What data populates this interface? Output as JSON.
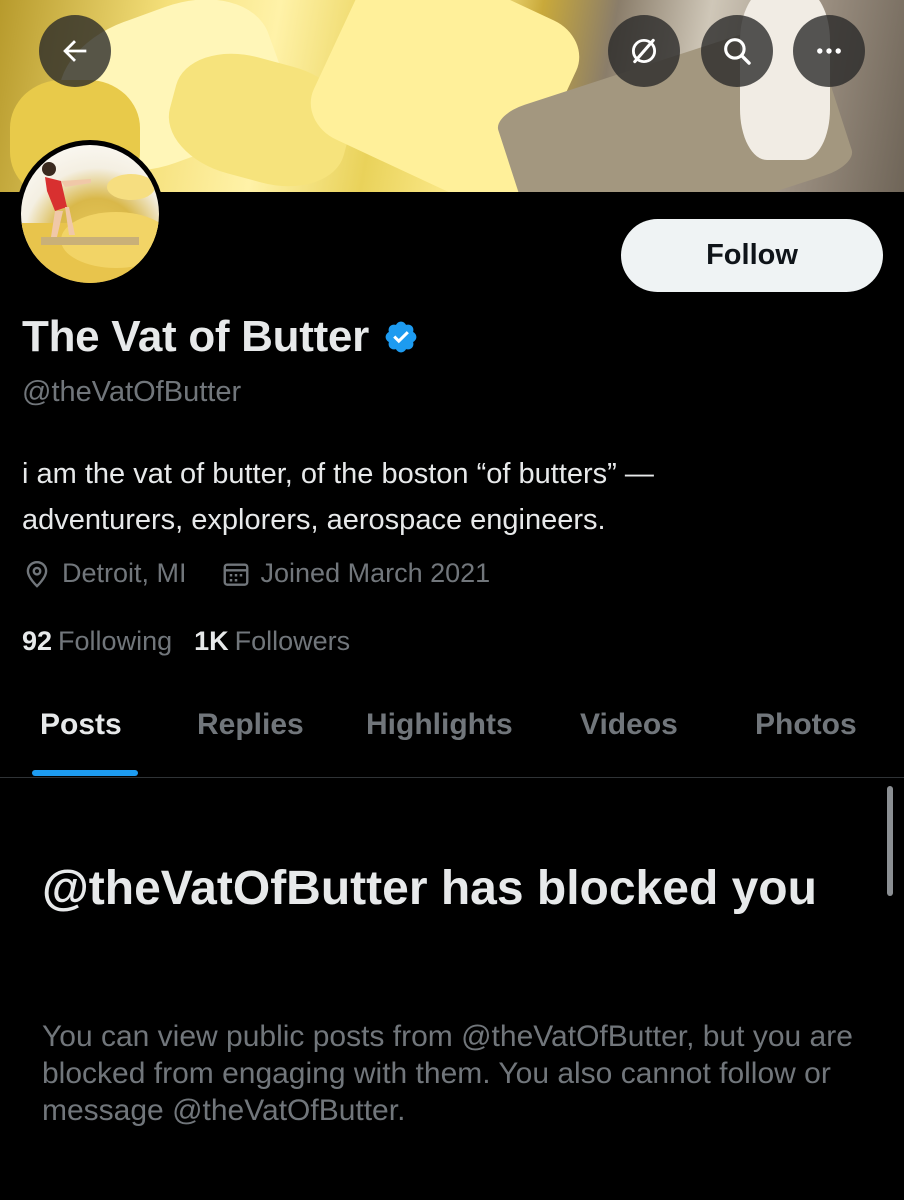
{
  "header": {
    "back_icon": "arrow-left-icon",
    "grok_icon": "slash-circle-icon",
    "search_icon": "search-icon",
    "more_icon": "more-icon"
  },
  "profile": {
    "display_name": "The Vat of Butter",
    "verified": true,
    "handle": "@theVatOfButter",
    "bio_line1": "i am the vat of butter, of the boston “of butters” —",
    "bio_line2": "adventurers, explorers, aerospace engineers.",
    "location": "Detroit, MI",
    "joined": "Joined March 2021",
    "following_count": "92",
    "following_label": "Following",
    "followers_count": "1K",
    "followers_label": "Followers",
    "follow_label": "Follow"
  },
  "tabs": [
    {
      "label": "Posts",
      "active": true
    },
    {
      "label": "Replies",
      "active": false
    },
    {
      "label": "Highlights",
      "active": false
    },
    {
      "label": "Videos",
      "active": false
    },
    {
      "label": "Photos",
      "active": false
    }
  ],
  "blocked": {
    "title": "@theVatOfButter has blocked you",
    "message": "You can view public posts from @theVatOfButter, but you are blocked from engaging with them. You also cannot follow or message @theVatOfButter."
  },
  "colors": {
    "background": "#000000",
    "accent": "#1d9bf0",
    "text_primary": "#e7e9ea",
    "text_secondary": "#71767b",
    "follow_button_bg": "#eff3f4"
  }
}
